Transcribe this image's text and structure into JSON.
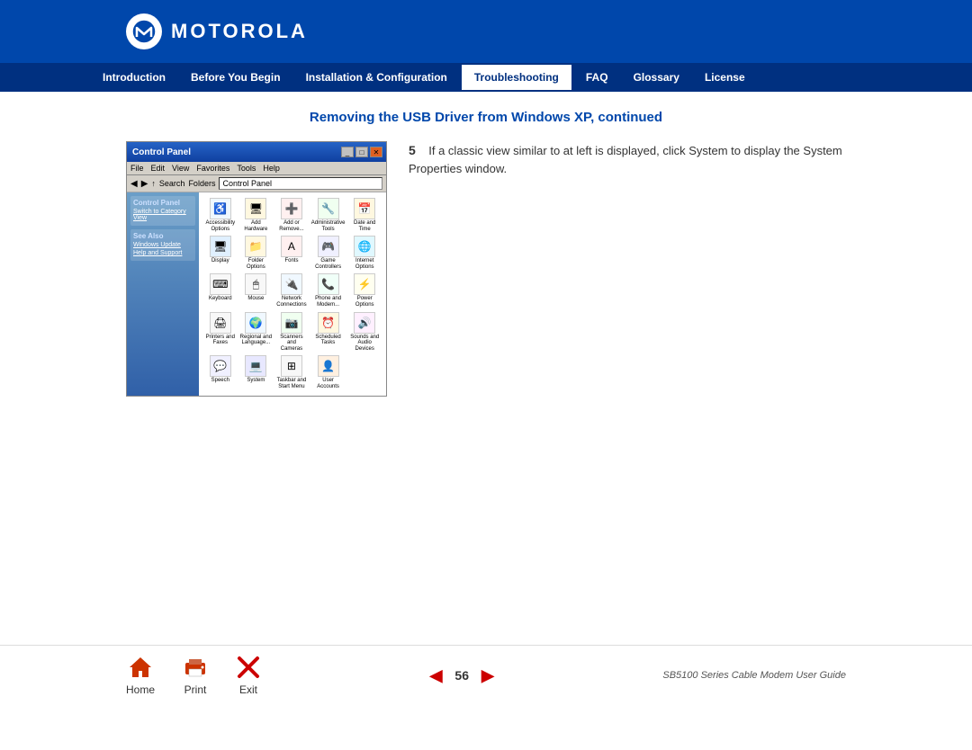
{
  "header": {
    "logo_text": "MOTOROLA",
    "logo_symbol": "M"
  },
  "navbar": {
    "items": [
      {
        "label": "Introduction",
        "active": false
      },
      {
        "label": "Before You Begin",
        "active": false
      },
      {
        "label": "Installation & Configuration",
        "active": false
      },
      {
        "label": "Troubleshooting",
        "active": true
      },
      {
        "label": "FAQ",
        "active": false
      },
      {
        "label": "Glossary",
        "active": false
      },
      {
        "label": "License",
        "active": false
      }
    ]
  },
  "main": {
    "page_title": "Removing the USB Driver from Windows XP, continued",
    "step_number": "5",
    "step_text": "If a classic view similar to at left is displayed, click System to display the System Properties window."
  },
  "screenshot": {
    "title": "Control Panel",
    "menubar": [
      "File",
      "Edit",
      "View",
      "Favorites",
      "Tools",
      "Help"
    ],
    "sidebar_sections": [
      {
        "title": "Control Panel",
        "links": [
          "Switch to Category View"
        ]
      },
      {
        "title": "See Also",
        "links": [
          "Windows Update",
          "Help and Support"
        ]
      }
    ],
    "icons": [
      {
        "symbol": "♿",
        "label": "Accessibility Options"
      },
      {
        "symbol": "🖥",
        "label": "Add Hardware"
      },
      {
        "symbol": "➕",
        "label": "Add or Remove..."
      },
      {
        "symbol": "🔧",
        "label": "Administrative Tools"
      },
      {
        "symbol": "📅",
        "label": "Date and Time"
      },
      {
        "symbol": "🖥",
        "label": "Display"
      },
      {
        "symbol": "📁",
        "label": "Folder Options"
      },
      {
        "symbol": "🖨",
        "label": "Fonts"
      },
      {
        "symbol": "🎮",
        "label": "Game Controllers"
      },
      {
        "symbol": "🌐",
        "label": "Internet Options"
      },
      {
        "symbol": "⌨",
        "label": "Keyboard"
      },
      {
        "symbol": "🖱",
        "label": "Mouse"
      },
      {
        "symbol": "🔌",
        "label": "Network Connections"
      },
      {
        "symbol": "📞",
        "label": "Phone and Modem..."
      },
      {
        "symbol": "⚡",
        "label": "Power Options"
      },
      {
        "symbol": "🖨",
        "label": "Printers and Faxes"
      },
      {
        "symbol": "🌍",
        "label": "Regional and Language..."
      },
      {
        "symbol": "🔊",
        "label": "Scanners and Cameras"
      },
      {
        "symbol": "📅",
        "label": "Scheduled Tasks"
      },
      {
        "symbol": "🔊",
        "label": "Sounds and Audio Devices"
      },
      {
        "symbol": "💬",
        "label": "Speech"
      },
      {
        "symbol": "💻",
        "label": "System"
      },
      {
        "symbol": "⌨",
        "label": "Taskbar and Start Menu"
      },
      {
        "symbol": "👤",
        "label": "User Accounts"
      }
    ]
  },
  "footer": {
    "home_label": "Home",
    "print_label": "Print",
    "exit_label": "Exit",
    "page_number": "56",
    "guide_title": "SB5100 Series Cable Modem User Guide"
  }
}
